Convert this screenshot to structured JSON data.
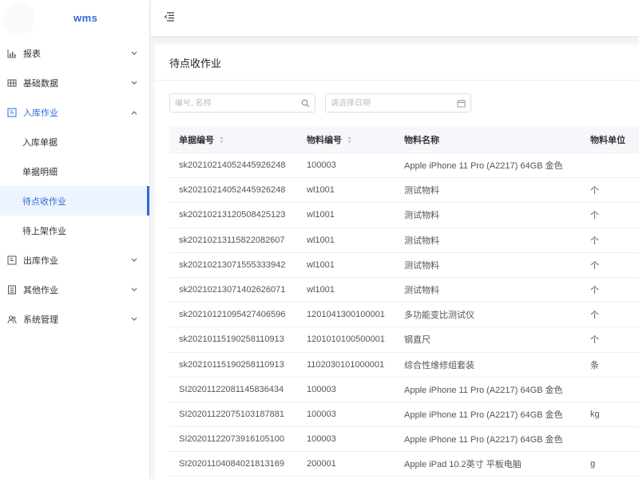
{
  "logo": {
    "text": "wms"
  },
  "sidebar": {
    "items": [
      {
        "label": "报表",
        "icon": "bar-chart-icon",
        "arrow": "down"
      },
      {
        "label": "基础数据",
        "icon": "grid-icon",
        "arrow": "down"
      },
      {
        "label": "入库作业",
        "icon": "inbound-icon",
        "arrow": "up",
        "open": true
      },
      {
        "label": "出库作业",
        "icon": "outbound-icon",
        "arrow": "down"
      },
      {
        "label": "其他作业",
        "icon": "list-icon",
        "arrow": "down"
      },
      {
        "label": "系统管理",
        "icon": "users-icon",
        "arrow": "down"
      }
    ],
    "submenu": [
      {
        "label": "入库单据"
      },
      {
        "label": "单据明细"
      },
      {
        "label": "待点收作业",
        "active": true
      },
      {
        "label": "待上架作业"
      }
    ]
  },
  "header": {
    "fold_icon": "menu-fold-icon"
  },
  "page": {
    "title": "待点收作业"
  },
  "filters": {
    "search_placeholder": "编号, 名称",
    "date_placeholder": "请选择日期"
  },
  "table": {
    "columns": [
      "单据编号",
      "物料编号",
      "物料名称",
      "物料单位"
    ],
    "rows": [
      [
        "sk20210214052445926248",
        "100003",
        "Apple iPhone 11 Pro (A2217) 64GB 金色",
        ""
      ],
      [
        "sk20210214052445926248",
        "wl1001",
        "测试物料",
        "个"
      ],
      [
        "sk20210213120508425123",
        "wl1001",
        "测试物料",
        "个"
      ],
      [
        "sk20210213115822082607",
        "wl1001",
        "测试物料",
        "个"
      ],
      [
        "sk20210213071555333942",
        "wl1001",
        "测试物料",
        "个"
      ],
      [
        "sk20210213071402626071",
        "wl1001",
        "测试物料",
        "个"
      ],
      [
        "sk20210121095427406596",
        "1201041300100001",
        "多功能变比测试仪",
        "个"
      ],
      [
        "sk20210115190258110913",
        "1201010100500001",
        "钢直尺",
        "个"
      ],
      [
        "sk20210115190258110913",
        "1102030101000001",
        "综合性维修组套装",
        "条"
      ],
      [
        "SI20201122081145836434",
        "100003",
        "Apple iPhone 11 Pro (A2217) 64GB 金色",
        ""
      ],
      [
        "SI20201122075103187881",
        "100003",
        "Apple iPhone 11 Pro (A2217) 64GB 金色",
        "kg"
      ],
      [
        "SI20201122073916105100",
        "100003",
        "Apple iPhone 11 Pro (A2217) 64GB 金色",
        ""
      ],
      [
        "SI20201104084021813169",
        "200001",
        "Apple iPad 10.2英寸 平板电脑",
        "g"
      ]
    ]
  },
  "colors": {
    "accent": "#2c6bd8",
    "active_bg": "#eef4ff"
  }
}
